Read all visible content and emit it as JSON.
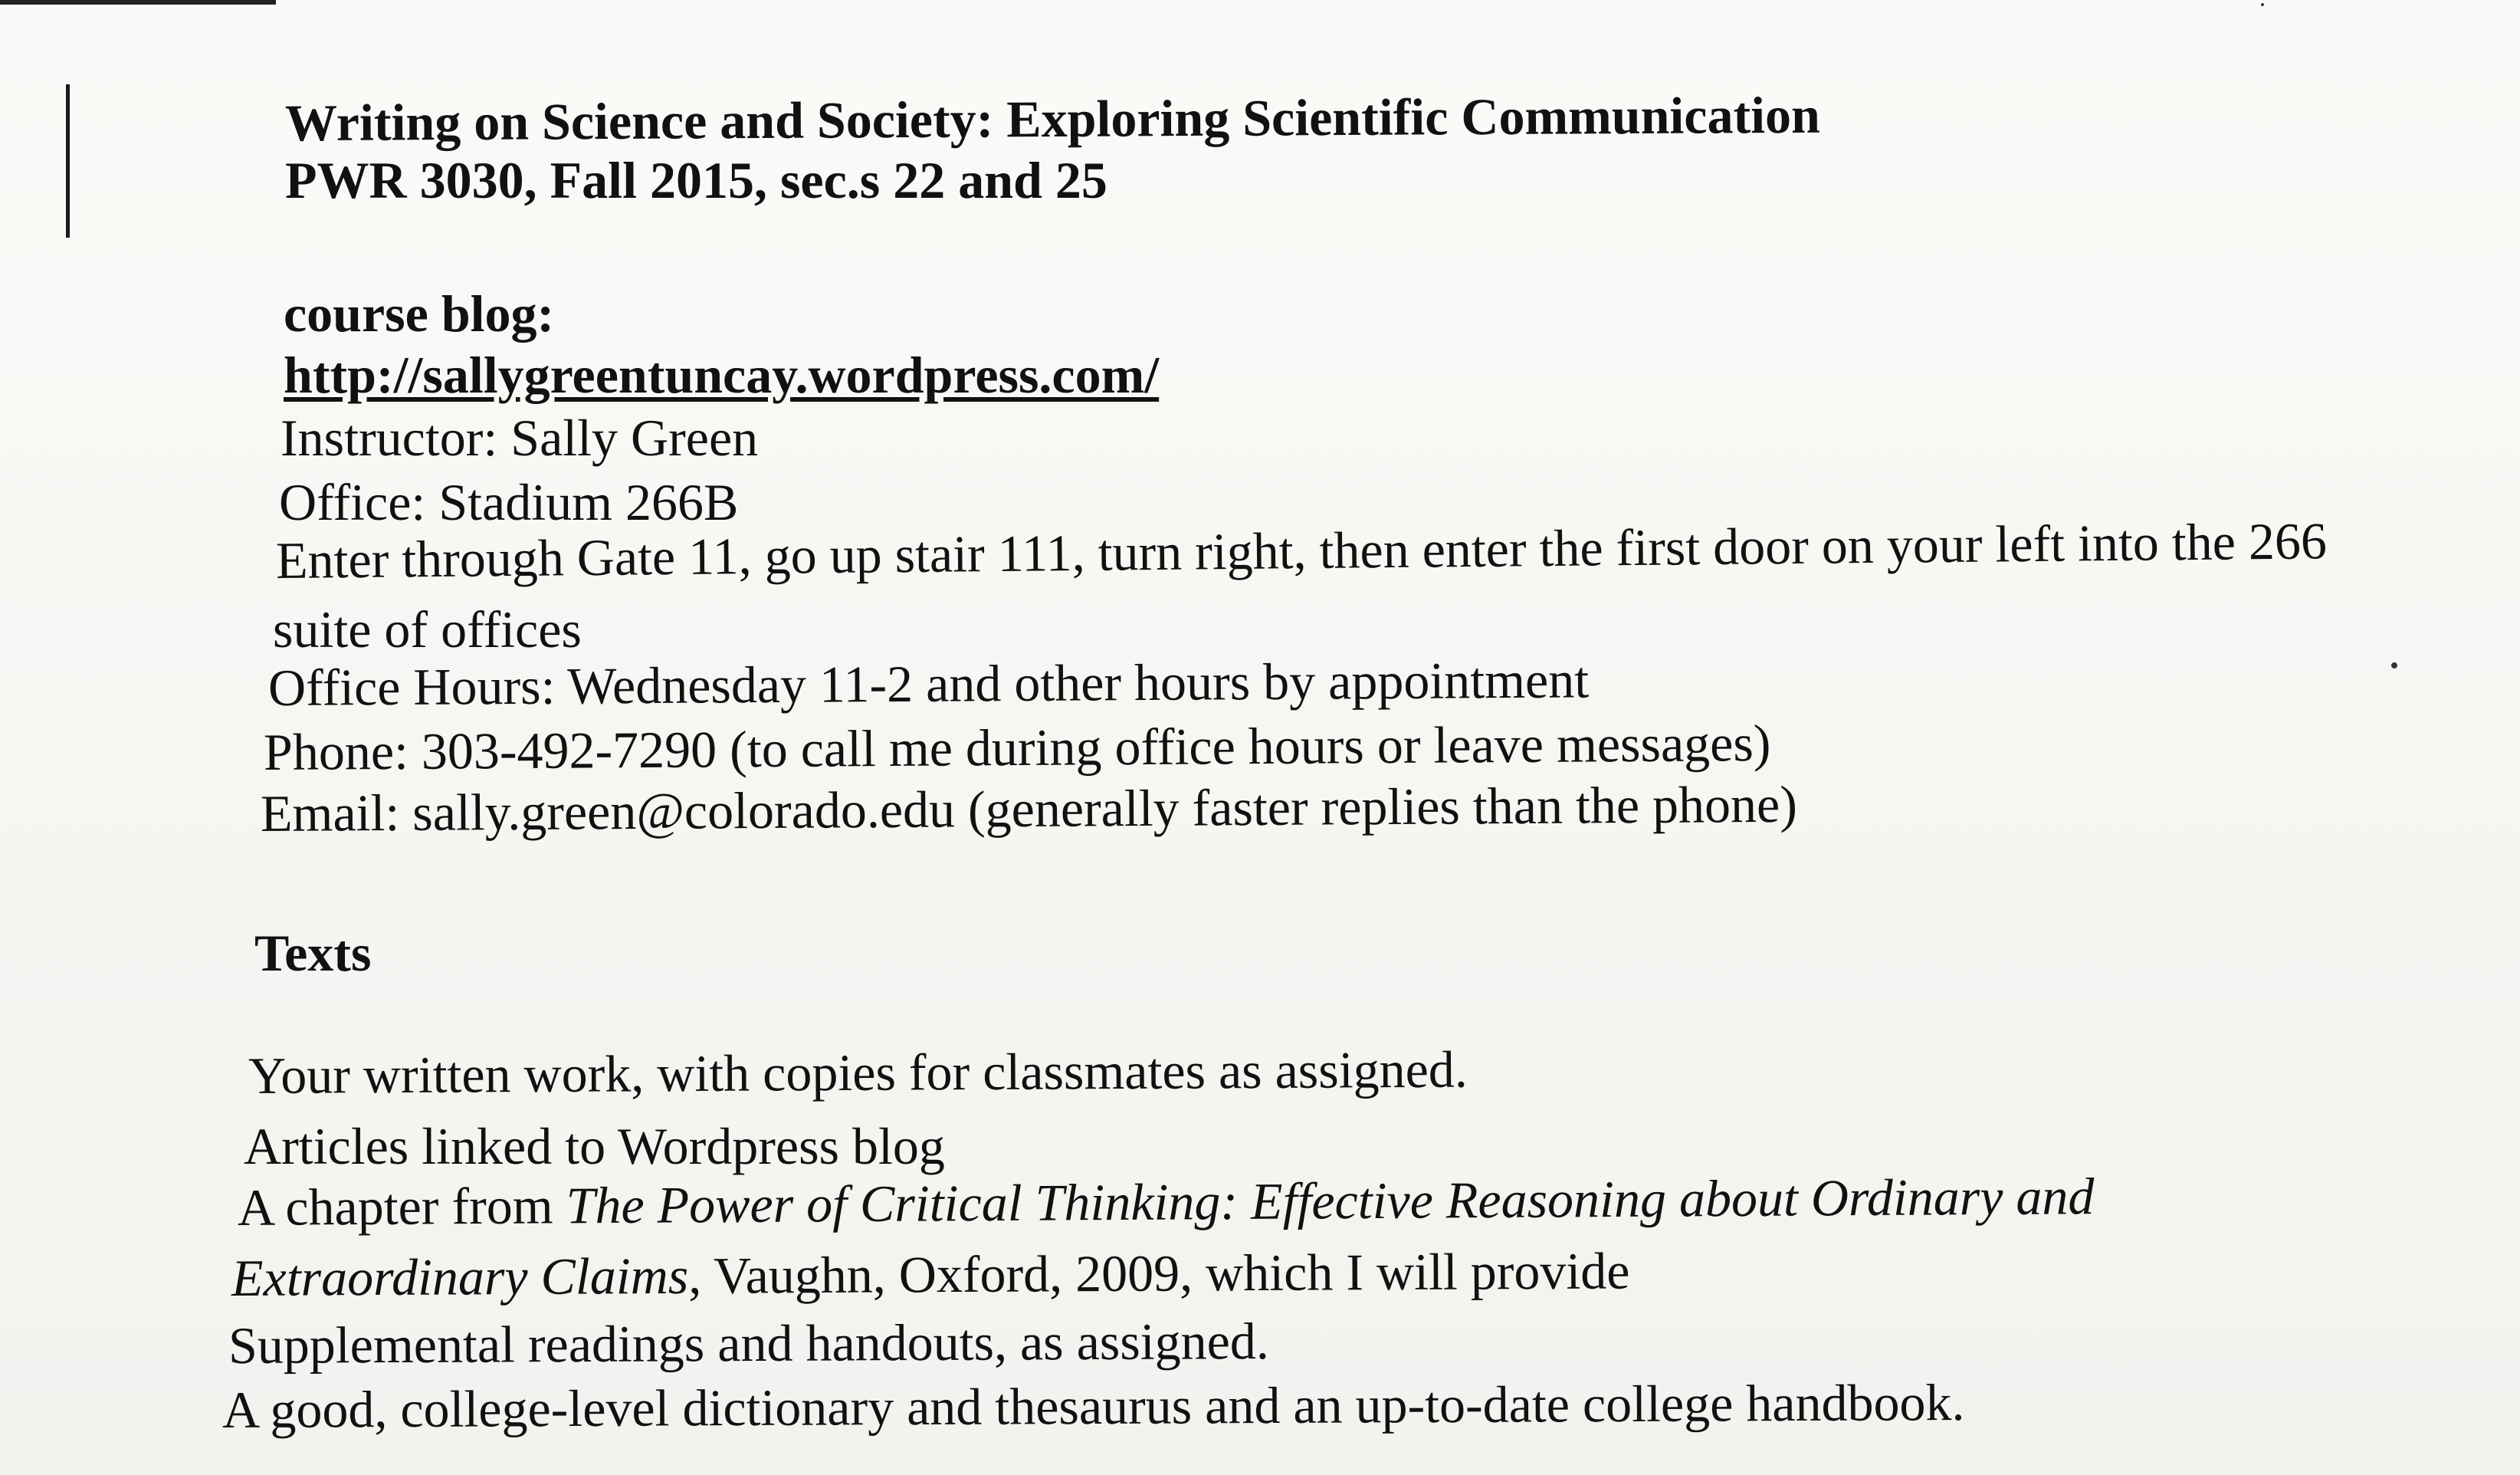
{
  "document": {
    "title_line1": "Writing on Science and Society: Exploring Scientific Communication",
    "title_line2": "PWR 3030, Fall 2015, sec.s 22 and 25",
    "blog_label": "course blog:",
    "blog_url": "http://sallygreentuncay.wordpress.com/",
    "instructor": "Instructor: Sally Green",
    "office": "Office: Stadium 266B",
    "directions_line1": "Enter through Gate 11, go up stair 111, turn right, then enter the first door on your left into the 266",
    "directions_line2": "suite of offices",
    "office_hours": "Office Hours:  Wednesday 11-2 and other hours by appointment",
    "phone": "Phone: 303-492-7290 (to call me during office hours or leave messages)",
    "email": "Email: sally.green@colorado.edu (generally faster replies than the phone)"
  },
  "texts_section": {
    "heading": "Texts",
    "item1": "Your written work, with copies for classmates as assigned.",
    "item2": "Articles linked to Wordpress blog",
    "item3_prefix": "A chapter from ",
    "item3_italic": "The Power of Critical Thinking: Effective Reasoning about Ordinary and",
    "item3_cont_italic": "Extraordinary Claims",
    "item3_suffix": ", Vaughn, Oxford, 2009, which I will provide",
    "item4": "Supplemental readings and handouts, as assigned.",
    "item5": "A good, college-level dictionary and thesaurus and an up-to-date college handbook."
  }
}
